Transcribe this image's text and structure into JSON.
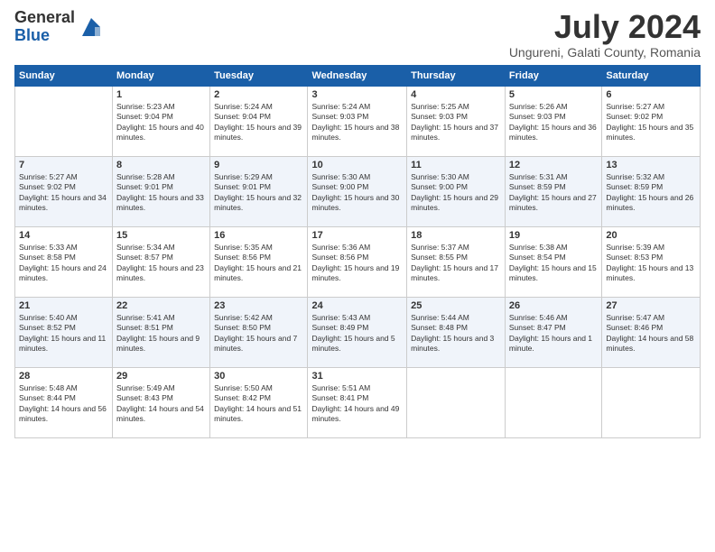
{
  "logo": {
    "general": "General",
    "blue": "Blue"
  },
  "title": "July 2024",
  "location": "Ungureni, Galati County, Romania",
  "days_of_week": [
    "Sunday",
    "Monday",
    "Tuesday",
    "Wednesday",
    "Thursday",
    "Friday",
    "Saturday"
  ],
  "weeks": [
    [
      {
        "day": "",
        "sunrise": "",
        "sunset": "",
        "daylight": ""
      },
      {
        "day": "1",
        "sunrise": "Sunrise: 5:23 AM",
        "sunset": "Sunset: 9:04 PM",
        "daylight": "Daylight: 15 hours and 40 minutes."
      },
      {
        "day": "2",
        "sunrise": "Sunrise: 5:24 AM",
        "sunset": "Sunset: 9:04 PM",
        "daylight": "Daylight: 15 hours and 39 minutes."
      },
      {
        "day": "3",
        "sunrise": "Sunrise: 5:24 AM",
        "sunset": "Sunset: 9:03 PM",
        "daylight": "Daylight: 15 hours and 38 minutes."
      },
      {
        "day": "4",
        "sunrise": "Sunrise: 5:25 AM",
        "sunset": "Sunset: 9:03 PM",
        "daylight": "Daylight: 15 hours and 37 minutes."
      },
      {
        "day": "5",
        "sunrise": "Sunrise: 5:26 AM",
        "sunset": "Sunset: 9:03 PM",
        "daylight": "Daylight: 15 hours and 36 minutes."
      },
      {
        "day": "6",
        "sunrise": "Sunrise: 5:27 AM",
        "sunset": "Sunset: 9:02 PM",
        "daylight": "Daylight: 15 hours and 35 minutes."
      }
    ],
    [
      {
        "day": "7",
        "sunrise": "Sunrise: 5:27 AM",
        "sunset": "Sunset: 9:02 PM",
        "daylight": "Daylight: 15 hours and 34 minutes."
      },
      {
        "day": "8",
        "sunrise": "Sunrise: 5:28 AM",
        "sunset": "Sunset: 9:01 PM",
        "daylight": "Daylight: 15 hours and 33 minutes."
      },
      {
        "day": "9",
        "sunrise": "Sunrise: 5:29 AM",
        "sunset": "Sunset: 9:01 PM",
        "daylight": "Daylight: 15 hours and 32 minutes."
      },
      {
        "day": "10",
        "sunrise": "Sunrise: 5:30 AM",
        "sunset": "Sunset: 9:00 PM",
        "daylight": "Daylight: 15 hours and 30 minutes."
      },
      {
        "day": "11",
        "sunrise": "Sunrise: 5:30 AM",
        "sunset": "Sunset: 9:00 PM",
        "daylight": "Daylight: 15 hours and 29 minutes."
      },
      {
        "day": "12",
        "sunrise": "Sunrise: 5:31 AM",
        "sunset": "Sunset: 8:59 PM",
        "daylight": "Daylight: 15 hours and 27 minutes."
      },
      {
        "day": "13",
        "sunrise": "Sunrise: 5:32 AM",
        "sunset": "Sunset: 8:59 PM",
        "daylight": "Daylight: 15 hours and 26 minutes."
      }
    ],
    [
      {
        "day": "14",
        "sunrise": "Sunrise: 5:33 AM",
        "sunset": "Sunset: 8:58 PM",
        "daylight": "Daylight: 15 hours and 24 minutes."
      },
      {
        "day": "15",
        "sunrise": "Sunrise: 5:34 AM",
        "sunset": "Sunset: 8:57 PM",
        "daylight": "Daylight: 15 hours and 23 minutes."
      },
      {
        "day": "16",
        "sunrise": "Sunrise: 5:35 AM",
        "sunset": "Sunset: 8:56 PM",
        "daylight": "Daylight: 15 hours and 21 minutes."
      },
      {
        "day": "17",
        "sunrise": "Sunrise: 5:36 AM",
        "sunset": "Sunset: 8:56 PM",
        "daylight": "Daylight: 15 hours and 19 minutes."
      },
      {
        "day": "18",
        "sunrise": "Sunrise: 5:37 AM",
        "sunset": "Sunset: 8:55 PM",
        "daylight": "Daylight: 15 hours and 17 minutes."
      },
      {
        "day": "19",
        "sunrise": "Sunrise: 5:38 AM",
        "sunset": "Sunset: 8:54 PM",
        "daylight": "Daylight: 15 hours and 15 minutes."
      },
      {
        "day": "20",
        "sunrise": "Sunrise: 5:39 AM",
        "sunset": "Sunset: 8:53 PM",
        "daylight": "Daylight: 15 hours and 13 minutes."
      }
    ],
    [
      {
        "day": "21",
        "sunrise": "Sunrise: 5:40 AM",
        "sunset": "Sunset: 8:52 PM",
        "daylight": "Daylight: 15 hours and 11 minutes."
      },
      {
        "day": "22",
        "sunrise": "Sunrise: 5:41 AM",
        "sunset": "Sunset: 8:51 PM",
        "daylight": "Daylight: 15 hours and 9 minutes."
      },
      {
        "day": "23",
        "sunrise": "Sunrise: 5:42 AM",
        "sunset": "Sunset: 8:50 PM",
        "daylight": "Daylight: 15 hours and 7 minutes."
      },
      {
        "day": "24",
        "sunrise": "Sunrise: 5:43 AM",
        "sunset": "Sunset: 8:49 PM",
        "daylight": "Daylight: 15 hours and 5 minutes."
      },
      {
        "day": "25",
        "sunrise": "Sunrise: 5:44 AM",
        "sunset": "Sunset: 8:48 PM",
        "daylight": "Daylight: 15 hours and 3 minutes."
      },
      {
        "day": "26",
        "sunrise": "Sunrise: 5:46 AM",
        "sunset": "Sunset: 8:47 PM",
        "daylight": "Daylight: 15 hours and 1 minute."
      },
      {
        "day": "27",
        "sunrise": "Sunrise: 5:47 AM",
        "sunset": "Sunset: 8:46 PM",
        "daylight": "Daylight: 14 hours and 58 minutes."
      }
    ],
    [
      {
        "day": "28",
        "sunrise": "Sunrise: 5:48 AM",
        "sunset": "Sunset: 8:44 PM",
        "daylight": "Daylight: 14 hours and 56 minutes."
      },
      {
        "day": "29",
        "sunrise": "Sunrise: 5:49 AM",
        "sunset": "Sunset: 8:43 PM",
        "daylight": "Daylight: 14 hours and 54 minutes."
      },
      {
        "day": "30",
        "sunrise": "Sunrise: 5:50 AM",
        "sunset": "Sunset: 8:42 PM",
        "daylight": "Daylight: 14 hours and 51 minutes."
      },
      {
        "day": "31",
        "sunrise": "Sunrise: 5:51 AM",
        "sunset": "Sunset: 8:41 PM",
        "daylight": "Daylight: 14 hours and 49 minutes."
      },
      {
        "day": "",
        "sunrise": "",
        "sunset": "",
        "daylight": ""
      },
      {
        "day": "",
        "sunrise": "",
        "sunset": "",
        "daylight": ""
      },
      {
        "day": "",
        "sunrise": "",
        "sunset": "",
        "daylight": ""
      }
    ]
  ]
}
